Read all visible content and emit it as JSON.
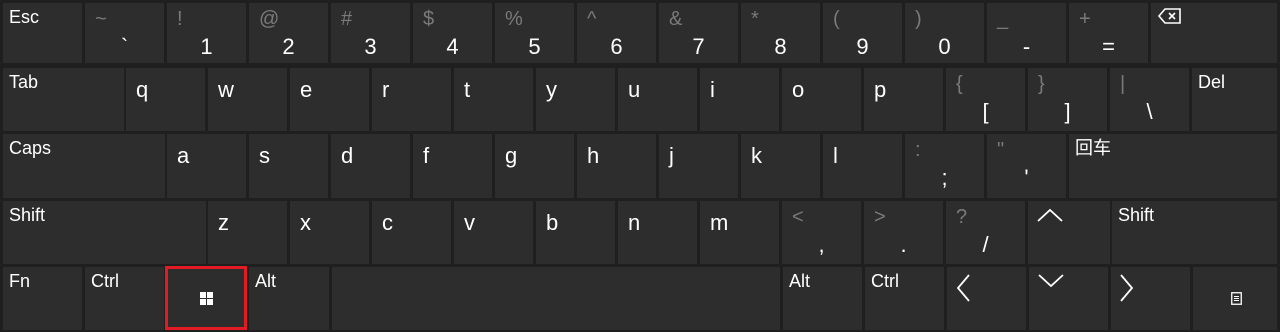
{
  "row1": {
    "esc": "Esc",
    "keys": [
      {
        "top": "~",
        "main": "`"
      },
      {
        "top": "!",
        "main": "1"
      },
      {
        "top": "@",
        "main": "2"
      },
      {
        "top": "#",
        "main": "3"
      },
      {
        "top": "$",
        "main": "4"
      },
      {
        "top": "%",
        "main": "5"
      },
      {
        "top": "^",
        "main": "6"
      },
      {
        "top": "&",
        "main": "7"
      },
      {
        "top": "*",
        "main": "8"
      },
      {
        "top": "(",
        "main": "9"
      },
      {
        "top": ")",
        "main": "0"
      },
      {
        "top": "_",
        "main": "-"
      },
      {
        "top": "+",
        "main": "="
      }
    ],
    "backspace_icon": "backspace-icon"
  },
  "row2": {
    "tab": "Tab",
    "letters": [
      "q",
      "w",
      "e",
      "r",
      "t",
      "y",
      "u",
      "i",
      "o",
      "p"
    ],
    "symbols": [
      {
        "top": "{",
        "main": "["
      },
      {
        "top": "}",
        "main": "]"
      },
      {
        "top": "|",
        "main": "\\"
      }
    ],
    "del": "Del"
  },
  "row3": {
    "caps": "Caps",
    "letters": [
      "a",
      "s",
      "d",
      "f",
      "g",
      "h",
      "j",
      "k",
      "l"
    ],
    "symbols": [
      {
        "top": ":",
        "main": ";"
      },
      {
        "top": "\"",
        "main": "'"
      }
    ],
    "enter": "回车"
  },
  "row4": {
    "shift_left": "Shift",
    "letters": [
      "z",
      "x",
      "c",
      "v",
      "b",
      "n",
      "m"
    ],
    "symbols": [
      {
        "top": "<",
        "main": ","
      },
      {
        "top": ">",
        "main": "."
      },
      {
        "top": "?",
        "main": "/"
      }
    ],
    "shift_right": "Shift"
  },
  "row5": {
    "fn": "Fn",
    "ctrl_left": "Ctrl",
    "windows_icon": "windows-icon",
    "alt_left": "Alt",
    "alt_right": "Alt",
    "ctrl_right": "Ctrl",
    "menu_icon": "menu-icon"
  },
  "colors": {
    "background": "#1f1f1f",
    "key": "#2d2d2d",
    "text": "#ffffff",
    "secondary_text": "#7a7a7a",
    "highlight": "#e21b24"
  }
}
